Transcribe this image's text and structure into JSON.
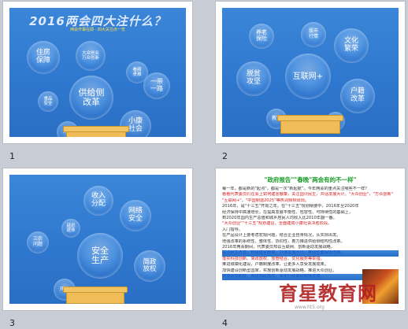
{
  "slides": [
    {
      "number": "1",
      "title": "2016两会四大注什么？",
      "subtitle": "两会开幕在即 · 四大关注点一览",
      "bubbles": [
        {
          "id": "housing",
          "label": "住房\n保障"
        },
        {
          "id": "employment",
          "label": "大众创业\n万众创新"
        },
        {
          "id": "medical",
          "label": "看病\n贵难"
        },
        {
          "id": "beltroad",
          "label": "一带\n一路"
        },
        {
          "id": "food",
          "label": "食品\n安全"
        },
        {
          "id": "supply",
          "label": "供给侧\n改革"
        },
        {
          "id": "shareholders",
          "label": "小康\n社会"
        },
        {
          "id": "bottom",
          "label": "环境"
        }
      ]
    },
    {
      "number": "2",
      "title": "",
      "bubbles": [
        {
          "id": "medicare",
          "label": "养老\n保险"
        },
        {
          "id": "stock",
          "label": "股市\n行情"
        },
        {
          "id": "culture",
          "label": "文化\n繁荣"
        },
        {
          "id": "poverty",
          "label": "脱贫\n攻坚"
        },
        {
          "id": "internet",
          "label": "互联网+"
        },
        {
          "id": "hukou",
          "label": "户籍\n改革"
        },
        {
          "id": "edu",
          "label": "教育"
        },
        {
          "id": "tax",
          "label": "财税"
        }
      ]
    },
    {
      "number": "3",
      "bubbles": [
        {
          "id": "income",
          "label": "收入\n分配"
        },
        {
          "id": "cyber",
          "label": "网络\n安全"
        },
        {
          "id": "pension",
          "label": "延迟\n退休"
        },
        {
          "id": "sannong",
          "label": "三农\n问题"
        },
        {
          "id": "safety",
          "label": "安全\n生产"
        },
        {
          "id": "admin",
          "label": "简政\n放权"
        },
        {
          "id": "env",
          "label": "环境"
        }
      ]
    },
    {
      "number": "4",
      "doc_title": "\"政府报告\"\"春晚\"两会有的不一样\"",
      "lines": [
        {
          "text": "每一年，都是新的\"起点\"，都是一次“新起航”。今年两会的重点关注哪些不一样？",
          "style": ""
        },
        {
          "text": "看看代表委员们在会上如何建言献策，关注国计民生，共话发展大计。\"大众创业\"，\"万众创新\"",
          "style": "red"
        },
        {
          "text": "\"互联网+\"，\"中国制造2025\"等热词频频出现。",
          "style": "red"
        },
        {
          "text": "2016年，是\"十三五\"开局之年。在\"十三五\"规划纲要中，2016年至2020年",
          "style": ""
        },
        {
          "text": "经济保持中高速增长，在提高发展平衡性、包容性、可持续性的基础上，",
          "style": ""
        },
        {
          "text": "到2020年国内生产总值和城乡居民人均收入比2010年翻一番。",
          "style": ""
        },
        {
          "text": "\"大众创业\"\"十三五\"规划建议，全面建成小康社会决胜阶段。",
          "style": "red"
        },
        {
          "text": "入门指导。",
          "style": ""
        },
        {
          "text": "在产品设计上要考虑宏观问题，结合企业自身情况，从实际出发。",
          "style": ""
        },
        {
          "text": "增强改革的系统性、整体性、协同性，着力推进供给侧结构性改革。",
          "style": ""
        },
        {
          "text": "2016年两会期间，代表委员热议互联网、创新驱动发展战略，",
          "style": ""
        },
        {
          "text": "关注民生改善，积极建言献策，共谋发展大计，推动全面深化改革。",
          "style": "blue"
        },
        {
          "text": "落实科技创新、简政放权、放管结合、优化服务等举措。",
          "style": "red"
        },
        {
          "text": "推进城镇化建设，户籍制度改革，让更多人享受发展成果。",
          "style": ""
        },
        {
          "text": "加快建设创新型国家，实施创新驱动发展战略，推进大众创业。",
          "style": ""
        },
        {
          "text": "转变政府职能，推进简政放权，深化行政审批制度改革。",
          "style": "blue"
        }
      ],
      "watermark": "育星教育网",
      "watermark_url": "www.ht5.org"
    }
  ]
}
